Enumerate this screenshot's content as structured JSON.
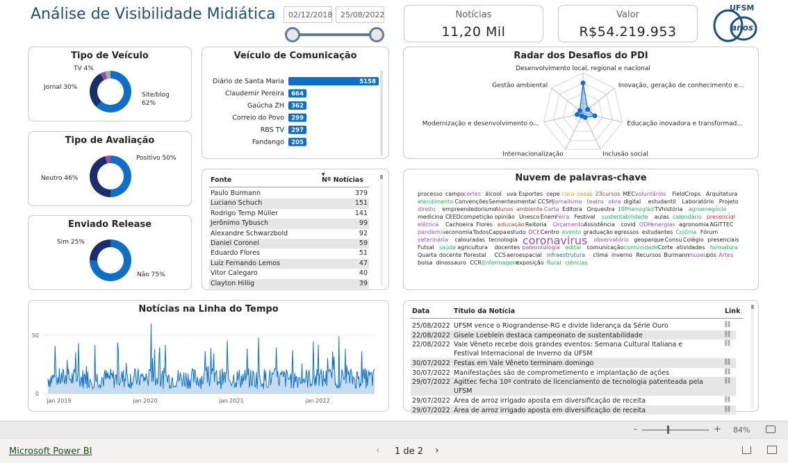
{
  "header": {
    "title": "Análise de Visibilidade Midiática",
    "date_start": "02/12/2018",
    "date_end": "25/08/2022",
    "logo_text": "UFSM",
    "logo_sub": "anos"
  },
  "kpis": {
    "noticias_label": "Notícias",
    "noticias_value": "11,20 Mil",
    "valor_label": "Valor",
    "valor_value": "R$54.219.953"
  },
  "tipo_veiculo": {
    "title": "Tipo de Veículo",
    "labels": [
      "TV 4%",
      "Jornal 30%",
      "Site/blog",
      "62%"
    ],
    "slices": [
      {
        "name": "Site/blog",
        "value": 62,
        "color": "#0f6fc6"
      },
      {
        "name": "Jornal",
        "value": 30,
        "color": "#1c2d6b"
      },
      {
        "name": "TV",
        "value": 4,
        "color": "#9a4fa3"
      },
      {
        "name": "Outros",
        "value": 4,
        "color": "#a7a9ac"
      }
    ]
  },
  "tipo_avaliacao": {
    "title": "Tipo de Avaliação",
    "labels": [
      "Positivo 50%",
      "Neutro 46%"
    ],
    "slices": [
      {
        "name": "Positivo",
        "value": 50,
        "color": "#0f6fc6"
      },
      {
        "name": "Neutro",
        "value": 46,
        "color": "#1c2d6b"
      },
      {
        "name": "Negativo",
        "value": 4,
        "color": "#9a4fa3"
      }
    ]
  },
  "enviado_release": {
    "title": "Enviado Release",
    "labels": [
      "Sim 25%",
      "Não 75%"
    ],
    "slices": [
      {
        "name": "Não",
        "value": 75,
        "color": "#0f6fc6"
      },
      {
        "name": "Sim",
        "value": 25,
        "color": "#1c2d6b"
      }
    ]
  },
  "veiculo_comunicacao": {
    "title": "Veículo de Comunicação",
    "bars": [
      {
        "label": "Diário de Santa Maria",
        "value": 5158
      },
      {
        "label": "Claudemir Pereira",
        "value": 664
      },
      {
        "label": "Gaúcha ZH",
        "value": 362
      },
      {
        "label": "Correio do Povo",
        "value": 299
      },
      {
        "label": "RBS TV",
        "value": 297
      },
      {
        "label": "Fandango",
        "value": 205
      }
    ]
  },
  "fonte_table": {
    "col_fonte": "Fonte",
    "col_noticias": "Nº Notícias",
    "rows": [
      {
        "fonte": "Paulo Burmann",
        "n": "379"
      },
      {
        "fonte": "Luciano Schuch",
        "n": "151"
      },
      {
        "fonte": "Rodrigo Temp Müller",
        "n": "141"
      },
      {
        "fonte": "Jerônimo Tybusch",
        "n": "99"
      },
      {
        "fonte": "Alexandre Schwarzbold",
        "n": "92"
      },
      {
        "fonte": "Daniel Coronel",
        "n": "59"
      },
      {
        "fonte": "Eduardo Flores",
        "n": "51"
      },
      {
        "fonte": "Luiz Fernando Lemos",
        "n": "47"
      },
      {
        "fonte": "Vitor Calegaro",
        "n": "40"
      },
      {
        "fonte": "Clayton Hillig",
        "n": "39"
      }
    ]
  },
  "radar": {
    "title": "Radar dos Desafios do PDI",
    "axes": [
      "Desenvolvimento local, regional e nacional",
      "Inovação, geração de conhecimento e...",
      "Educação inovadora e transformad...",
      "Inclusão social",
      "Internacionalização",
      "Modernização e desenvolvimento o...",
      "Gestão ambiental"
    ],
    "values": [
      0.75,
      0.15,
      0.3,
      0.12,
      0.08,
      0.15,
      0.1
    ]
  },
  "nuvem": {
    "title": "Nuvem de palavras-chave",
    "words": [
      {
        "w": "processo",
        "c": "#252423",
        "s": 8
      },
      {
        "w": "campo",
        "c": "#252423",
        "s": 8
      },
      {
        "w": "cortes",
        "c": "#9a4fa3",
        "s": 8
      },
      {
        "w": "álcool",
        "c": "#252423",
        "s": 8
      },
      {
        "w": "uva",
        "c": "#252423",
        "s": 8
      },
      {
        "w": "Esportes",
        "c": "#252423",
        "s": 8
      },
      {
        "w": "cepe",
        "c": "#252423",
        "s": 8
      },
      {
        "w": "casa",
        "c": "#d4b106",
        "s": 8
      },
      {
        "w": "cosas",
        "c": "#e08a00",
        "s": 8
      },
      {
        "w": "23cursos",
        "c": "#c0392b",
        "s": 8
      },
      {
        "w": "MEC",
        "c": "#252423",
        "s": 8
      },
      {
        "w": "voluntários",
        "c": "#9a4fa3",
        "s": 8
      },
      {
        "w": "FieldCrops",
        "c": "#252423",
        "s": 8
      },
      {
        "w": "Arquitetura",
        "c": "#252423",
        "s": 8
      },
      {
        "w": "atendimento",
        "c": "#27ae60",
        "s": 8
      },
      {
        "w": "Convenções",
        "c": "#252423",
        "s": 8
      },
      {
        "w": "Sementes",
        "c": "#252423",
        "s": 8
      },
      {
        "w": "mental",
        "c": "#252423",
        "s": 8
      },
      {
        "w": "CCSH",
        "c": "#252423",
        "s": 8
      },
      {
        "w": "Jornalismo",
        "c": "#9a4fa3",
        "s": 8
      },
      {
        "w": "teatro",
        "c": "#9a4fa3",
        "s": 8
      },
      {
        "w": "obra",
        "c": "#9a4fa3",
        "s": 8
      },
      {
        "w": "digital",
        "c": "#252423",
        "s": 8
      },
      {
        "w": "estudantil",
        "c": "#252423",
        "s": 8
      },
      {
        "w": "Laboratório",
        "c": "#252423",
        "s": 8
      },
      {
        "w": "Projeto",
        "c": "#252423",
        "s": 8
      },
      {
        "w": "direito",
        "c": "#9a4fa3",
        "s": 8
      },
      {
        "w": "empreendedorismo",
        "c": "#252423",
        "s": 8
      },
      {
        "w": "Alunos",
        "c": "#c0392b",
        "s": 8
      },
      {
        "w": "ambiente",
        "c": "#c0392b",
        "s": 8
      },
      {
        "w": "Carta",
        "c": "#9a4fa3",
        "s": 8
      },
      {
        "w": "Editora",
        "c": "#252423",
        "s": 8
      },
      {
        "w": "Orquestra",
        "c": "#252423",
        "s": 8
      },
      {
        "w": "19Phenoglad",
        "c": "#27ae60",
        "s": 8
      },
      {
        "w": "TVhistória",
        "c": "#252423",
        "s": 8
      },
      {
        "w": "agroenegócio",
        "c": "#27ae60",
        "s": 8
      },
      {
        "w": "medicina",
        "c": "#252423",
        "s": 8
      },
      {
        "w": "CEED",
        "c": "#252423",
        "s": 8
      },
      {
        "w": "competição",
        "c": "#252423",
        "s": 8
      },
      {
        "w": "opinião",
        "c": "#252423",
        "s": 8
      },
      {
        "w": "Unesco",
        "c": "#252423",
        "s": 8
      },
      {
        "w": "Enem",
        "c": "#252423",
        "s": 8
      },
      {
        "w": "Feira",
        "c": "#9a4fa3",
        "s": 8
      },
      {
        "w": "Festival",
        "c": "#252423",
        "s": 8
      },
      {
        "w": "sustentabilidade",
        "c": "#27ae60",
        "s": 8
      },
      {
        "w": "aulas",
        "c": "#252423",
        "s": 8
      },
      {
        "w": "calendário",
        "c": "#27ae60",
        "s": 8
      },
      {
        "w": "presencial",
        "c": "#c0392b",
        "s": 8
      },
      {
        "w": "elétrica",
        "c": "#9a4fa3",
        "s": 8
      },
      {
        "w": "Cachoeira",
        "c": "#252423",
        "s": 8
      },
      {
        "w": "Flores",
        "c": "#252423",
        "s": 8
      },
      {
        "w": "educação",
        "c": "#c0392b",
        "s": 8
      },
      {
        "w": "Reitoria",
        "c": "#252423",
        "s": 8
      },
      {
        "w": "Orçamento",
        "c": "#9a4fa3",
        "s": 8
      },
      {
        "w": "Assistência",
        "c": "#252423",
        "s": 8
      },
      {
        "w": "covid",
        "c": "#252423",
        "s": 8
      },
      {
        "w": "ODH",
        "c": "#9a4fa3",
        "s": 8
      },
      {
        "w": "energias",
        "c": "#9a4fa3",
        "s": 8
      },
      {
        "w": "agronomia",
        "c": "#252423",
        "s": 8
      },
      {
        "w": "AGITTEC",
        "c": "#252423",
        "s": 8
      },
      {
        "w": "pandemia",
        "c": "#9a4fa3",
        "s": 8
      },
      {
        "w": "economia",
        "c": "#252423",
        "s": 8
      },
      {
        "w": "TodosCappa",
        "c": "#252423",
        "s": 8
      },
      {
        "w": "estudo",
        "c": "#252423",
        "s": 8
      },
      {
        "w": "DCE",
        "c": "#9a4fa3",
        "s": 8
      },
      {
        "w": "Centro",
        "c": "#252423",
        "s": 8
      },
      {
        "w": "evento",
        "c": "#27ae60",
        "s": 8
      },
      {
        "w": "graduação",
        "c": "#252423",
        "s": 8
      },
      {
        "w": "egressos",
        "c": "#252423",
        "s": 8
      },
      {
        "w": "estudantes",
        "c": "#252423",
        "s": 8
      },
      {
        "w": "Colônia",
        "c": "#27ae60",
        "s": 8
      },
      {
        "w": "Fórum",
        "c": "#252423",
        "s": 8
      },
      {
        "w": "veterinária",
        "c": "#9a4fa3",
        "s": 8
      },
      {
        "w": "calouradas",
        "c": "#252423",
        "s": 8
      },
      {
        "w": "tecnologia",
        "c": "#252423",
        "s": 8
      },
      {
        "w": "coronavirus",
        "c": "#9a4fa3",
        "s": 16
      },
      {
        "w": "observatório",
        "c": "#9a4fa3",
        "s": 8
      },
      {
        "w": "geoparque",
        "c": "#252423",
        "s": 8
      },
      {
        "w": "Consu",
        "c": "#252423",
        "s": 8
      },
      {
        "w": "Colégio",
        "c": "#252423",
        "s": 8
      },
      {
        "w": "presenciais",
        "c": "#252423",
        "s": 8
      },
      {
        "w": "Futsal",
        "c": "#252423",
        "s": 8
      },
      {
        "w": "saúde",
        "c": "#27ae60",
        "s": 8
      },
      {
        "w": "agricultura",
        "c": "#252423",
        "s": 8
      },
      {
        "w": "docentes",
        "c": "#252423",
        "s": 8
      },
      {
        "w": "paleontologia",
        "c": "#9a4fa3",
        "s": 8
      },
      {
        "w": "edital",
        "c": "#27ae60",
        "s": 8
      },
      {
        "w": "comunicação",
        "c": "#252423",
        "s": 8
      },
      {
        "w": "comunidade",
        "c": "#27ae60",
        "s": 8
      },
      {
        "w": "Corte",
        "c": "#252423",
        "s": 8
      },
      {
        "w": "atividades",
        "c": "#252423",
        "s": 8
      },
      {
        "w": "formatura",
        "c": "#27ae60",
        "s": 8
      },
      {
        "w": "Quarta",
        "c": "#252423",
        "s": 8
      },
      {
        "w": "docente",
        "c": "#252423",
        "s": 8
      },
      {
        "w": "florestal",
        "c": "#252423",
        "s": 8
      },
      {
        "w": "CCS",
        "c": "#252423",
        "s": 8
      },
      {
        "w": "aeroespacial",
        "c": "#252423",
        "s": 8
      },
      {
        "w": "infraestrutura",
        "c": "#0f6fc6",
        "s": 8
      },
      {
        "w": "clima",
        "c": "#252423",
        "s": 8
      },
      {
        "w": "inverno",
        "c": "#252423",
        "s": 8
      },
      {
        "w": "Recursos",
        "c": "#252423",
        "s": 8
      },
      {
        "w": "Burmann",
        "c": "#252423",
        "s": 8
      },
      {
        "w": "museu",
        "c": "#9a4fa3",
        "s": 8
      },
      {
        "w": "pós",
        "c": "#252423",
        "s": 8
      },
      {
        "w": "Artes",
        "c": "#9a4fa3",
        "s": 8
      },
      {
        "w": "bolsa",
        "c": "#252423",
        "s": 8
      },
      {
        "w": "dinossauro",
        "c": "#252423",
        "s": 8
      },
      {
        "w": "CCR",
        "c": "#252423",
        "s": 8
      },
      {
        "w": "Enfermagem",
        "c": "#27ae60",
        "s": 8
      },
      {
        "w": "exposição",
        "c": "#252423",
        "s": 8
      },
      {
        "w": "Rural",
        "c": "#27ae60",
        "s": 8
      },
      {
        "w": "ciências",
        "c": "#27ae60",
        "s": 8
      }
    ]
  },
  "timeline": {
    "title": "Notícias na Linha do Tempo",
    "y_ticks": [
      "50",
      "0"
    ],
    "x_ticks": [
      "jan 2019",
      "jan 2020",
      "jan 2021",
      "jan 2022"
    ]
  },
  "news_table": {
    "col_data": "Data",
    "col_titulo": "Título da Notícia",
    "col_link": "Link",
    "rows": [
      {
        "data": "25/08/2022",
        "titulo": "UFSM vence o Riograndense-RG e divide liderança da Série Ouro"
      },
      {
        "data": "22/08/2022",
        "titulo": "Gisele Loeblein destaca campeonato de sustentabilidade"
      },
      {
        "data": "22/08/2022",
        "titulo": "Vale Vêneto recebe dois grandes eventos: Semana Cultural Italiana e Festival Internacional de Inverno da UFSM"
      },
      {
        "data": "30/07/2022",
        "titulo": "Festas em Vale Vêneto terminam domingo"
      },
      {
        "data": "30/07/2022",
        "titulo": "Manifestações são de comprometimento e implantação de ações"
      },
      {
        "data": "29/07/2022",
        "titulo": "Agittec fecha 10º contrato de licenciamento de tecnologia patenteada pela UFSM"
      },
      {
        "data": "29/07/2022",
        "titulo": "Área de arroz irrigado aposta em diversificação de receita"
      },
      {
        "data": "29/07/2022",
        "titulo": "Área de arroz irrigado aposta em diversificação de receita"
      }
    ]
  },
  "zoom": {
    "minus": "-",
    "plus": "+",
    "level": "84%"
  },
  "footer": {
    "brand": "Microsoft Power BI",
    "page_indicator": "1 de 2"
  }
}
